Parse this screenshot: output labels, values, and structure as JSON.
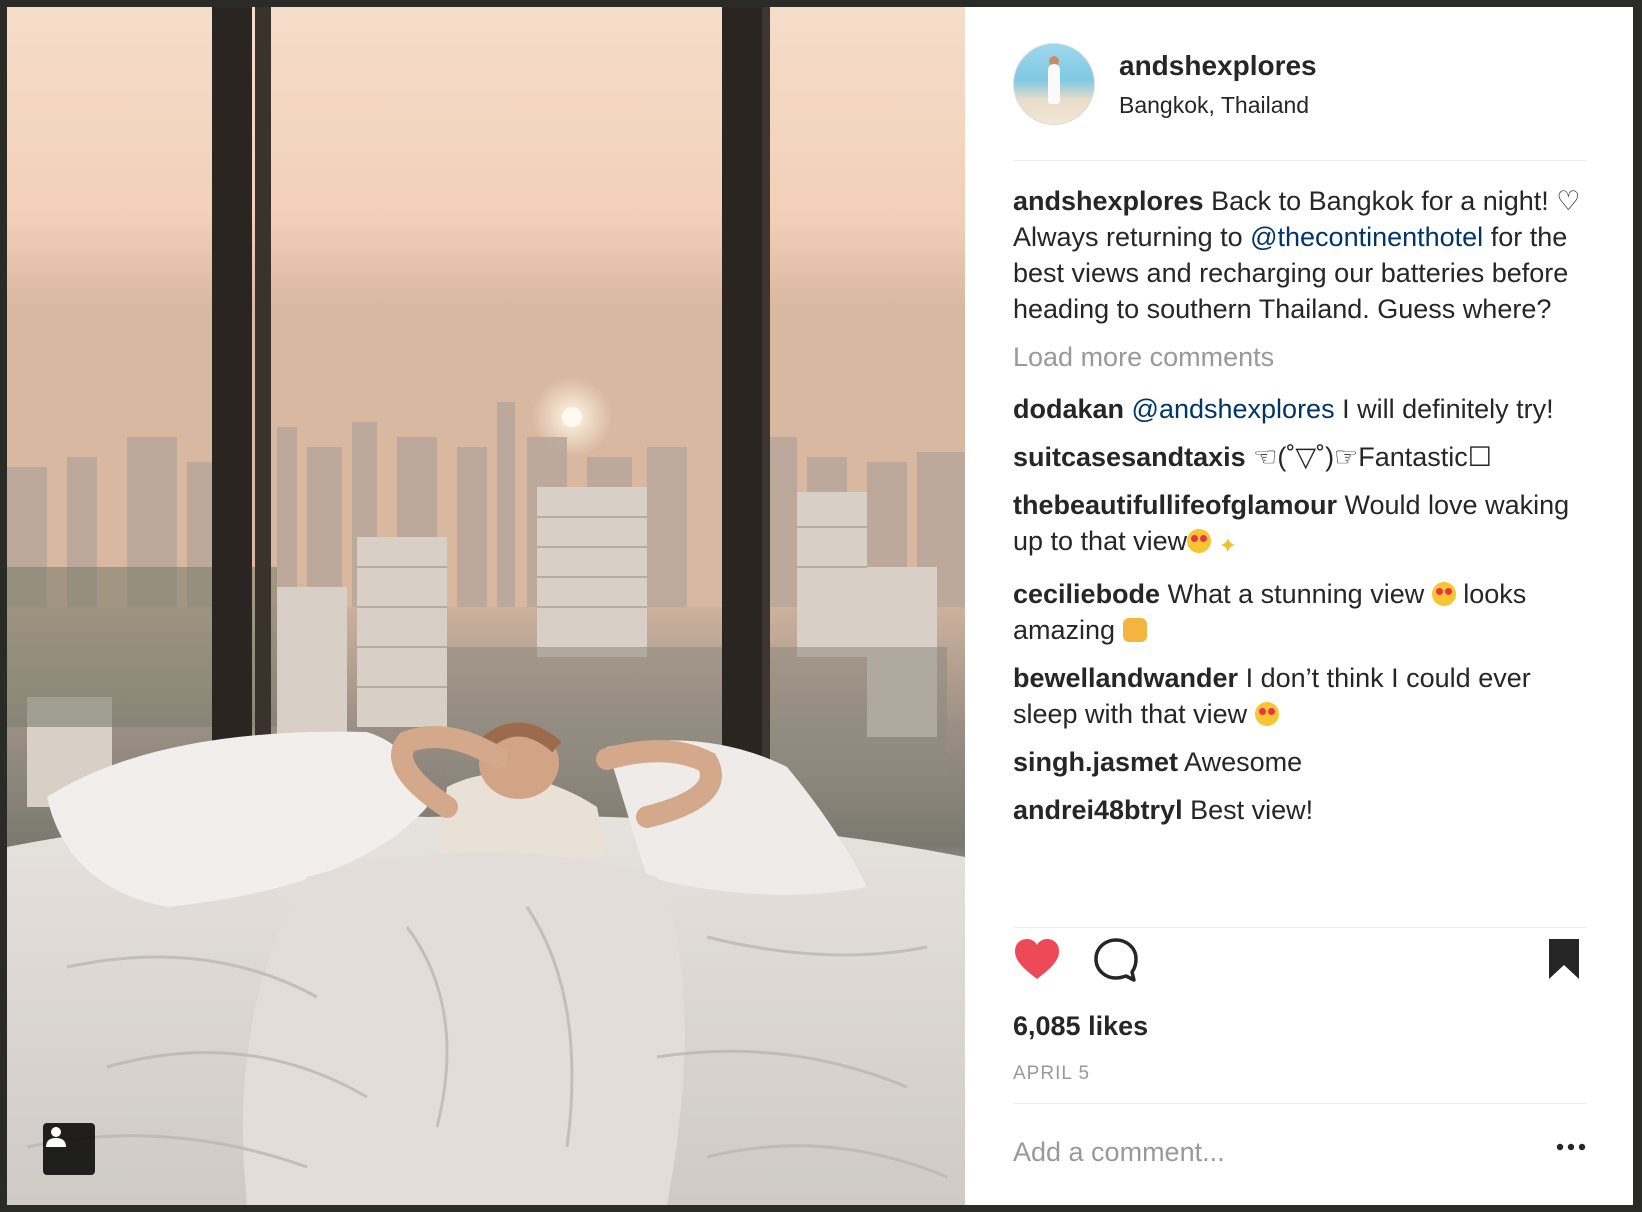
{
  "post": {
    "username": "andshexplores",
    "location": "Bangkok, Thailand",
    "caption": {
      "username": "andshexplores",
      "text_before": " Back to Bangkok for a night! ♡ Always returning to ",
      "mention": "@thecontinenthotel",
      "text_after": " for the best views and recharging our batteries before heading to southern Thailand. Guess where?"
    },
    "load_more_label": "Load more comments",
    "comments": [
      {
        "username": "dodakan",
        "mention": "@andshexplores",
        "text": " I will definitely try!"
      },
      {
        "username": "suitcasesandtaxis",
        "text": " ☜(˚▽˚)☞Fantastic☐"
      },
      {
        "username": "thebeautifullifeofglamour",
        "text": " Would love waking up to that view"
      },
      {
        "username": "ceciliebode",
        "text": " What a stunning view ",
        "text_after": "  looks amazing "
      },
      {
        "username": "bewellandwander",
        "text": " I don’t think I could ever sleep with that view "
      },
      {
        "username": "singh.jasmet",
        "text": " Awesome"
      },
      {
        "username": "andrei48btryl",
        "text": " Best view!"
      }
    ],
    "likes": "6,085 likes",
    "date": "APRIL 5",
    "add_comment_placeholder": "Add a comment...",
    "icons": {
      "like": "heart-filled-icon",
      "comment": "comment-bubble-icon",
      "save": "bookmark-filled-icon",
      "more": "more-horizontal-icon",
      "user_tag": "person-tag-icon"
    },
    "colors": {
      "like": "#ed4956",
      "mention": "#003569",
      "muted": "#999999"
    }
  }
}
